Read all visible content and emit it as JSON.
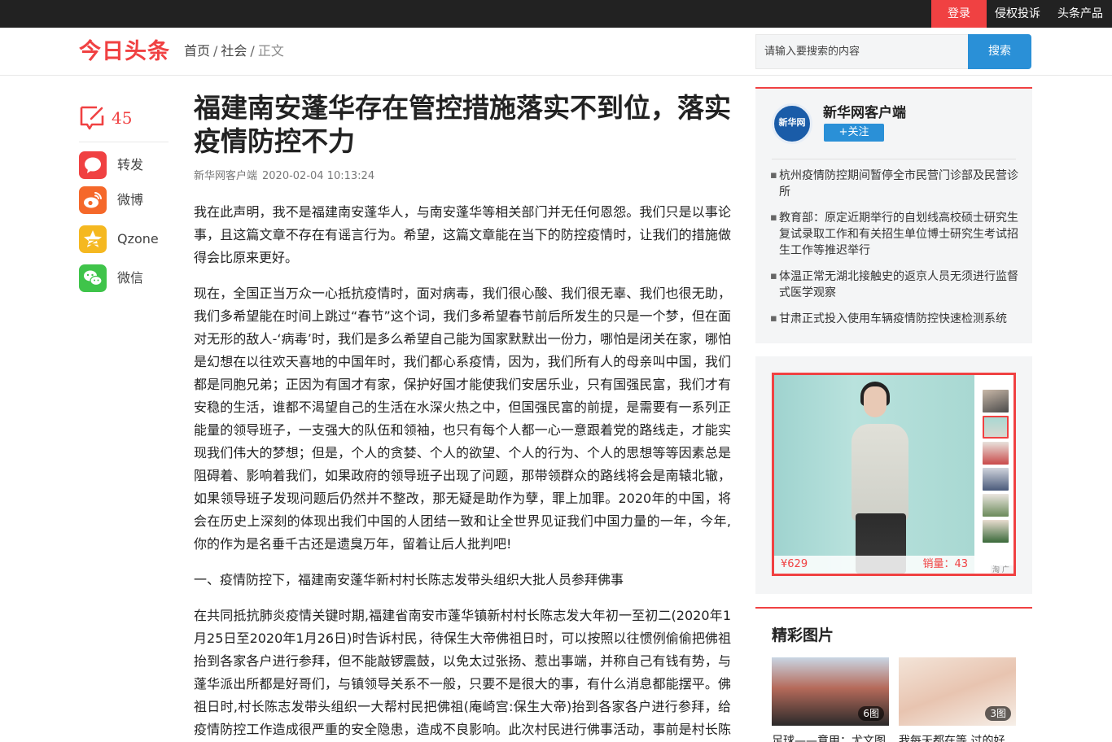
{
  "topbar": {
    "login": "登录",
    "complaint": "侵权投诉",
    "products": "头条产品"
  },
  "header": {
    "logo": "今日头条",
    "breadcrumb": [
      "首页",
      "社会",
      "正文"
    ],
    "search_placeholder": "请输入要搜索的内容",
    "search_button": "搜索"
  },
  "left": {
    "comment_count": "45",
    "shares": [
      {
        "label": "转发",
        "icon": "repost-icon",
        "color": "#f04142"
      },
      {
        "label": "微博",
        "icon": "weibo-icon",
        "color": "#f5682a"
      },
      {
        "label": "Qzone",
        "icon": "qzone-star-icon",
        "color": "#f5b820"
      },
      {
        "label": "微信",
        "icon": "wechat-icon",
        "color": "#3fc44a"
      }
    ]
  },
  "article": {
    "title": "福建南安蓬华存在管控措施落实不到位，落实疫情防控不力",
    "source": "新华网客户端",
    "time": "2020-02-04 10:13:24",
    "paragraphs": [
      "我在此声明，我不是福建南安蓬华人，与南安蓬华等相关部门并无任何恩怨。我们只是以事论事，且这篇文章不存在有谣言行为。希望，这篇文章能在当下的防控疫情时，让我们的措施做得会比原来更好。",
      "现在，全国正当万众一心抵抗疫情时，面对病毒，我们很心酸、我们很无辜、我们也很无助，我们多希望能在时间上跳过“春节”这个词，我们多希望春节前后所发生的只是一个梦，但在面对无形的敌人-‘病毒’时，我们是多么希望自己能为国家默默出一份力，哪怕是闭关在家，哪怕是幻想在以往欢天喜地的中国年时，我们都心系疫情，因为，我们所有人的母亲叫中国，我们都是同胞兄弟；正因为有国才有家，保护好国才能使我们安居乐业，只有国强民富，我们才有安稳的生活，谁都不渴望自己的生活在水深火热之中，但国强民富的前提，是需要有一系列正能量的领导班子，一支强大的队伍和领袖，也只有每个人都一心一意跟着党的路线走，才能实现我们伟大的梦想；但是，个人的贪婪、个人的欲望、个人的行为、个人的思想等等因素总是阻碍着、影响着我们，如果政府的领导班子出现了问题，那带领群众的路线将会是南辕北辙，如果领导班子发现问题后仍然并不整改，那无疑是助作为孽，罪上加罪。2020年的中国，将会在历史上深刻的体现出我们中国的人团结一致和让全世界见证我们中国力量的一年，今年,你的作为是名垂千古还是遗臭万年，留着让后人批判吧!",
      "一、疫情防控下，福建南安蓬华新村村长陈志发带头组织大批人员参拜佛事",
      "在共同抵抗肺炎疫情关键时期,福建省南安市蓬华镇新村村长陈志发大年初一至初二(2020年1月25日至2020年1月26日)时告诉村民，待保生大帝佛祖日时，可以按照以往惯例偷偷把佛祖抬到各家各户进行参拜，但不能敲锣震鼓，以免太过张扬、惹出事端，并称自己有钱有势，与蓬华派出所都是好哥们，与镇领导关系不一般，只要不是很大的事，有什么消息都能摆平。佛祖日时,村长陈志发带头组织一大帮村民把佛祖(庵崎宫:保生大帝)抬到各家各户进行参拜，给疫情防控工作造成很严重的安全隐患，造成不良影响。此次村民进行佛事活动，事前是村长陈志"
    ]
  },
  "author": {
    "avatar_text": "新华网",
    "name": "新华网客户端",
    "follow": "关注",
    "news": [
      "杭州疫情防控期间暂停全市民营门诊部及民营诊所",
      "教育部：原定近期举行的自划线高校硕士研究生复试录取工作和有关招生单位博士研究生考试招生工作等推迟举行",
      "体温正常无湖北接触史的返京人员无须进行监督式医学观察",
      "甘肃正式投入使用车辆疫情防控快速检测系统"
    ]
  },
  "ad": {
    "price": "¥629",
    "sales": "销量：43",
    "tag": "淘 广告"
  },
  "pictures": {
    "title": "精彩图片",
    "items": [
      {
        "count": "6图",
        "caption": "足球——意甲：尤文图"
      },
      {
        "count": "3图",
        "caption": "我每天都在等,过的好"
      }
    ]
  },
  "colors": {
    "brand_red": "#f04142",
    "search_blue": "#2a90d7",
    "topbar": "#222222"
  }
}
